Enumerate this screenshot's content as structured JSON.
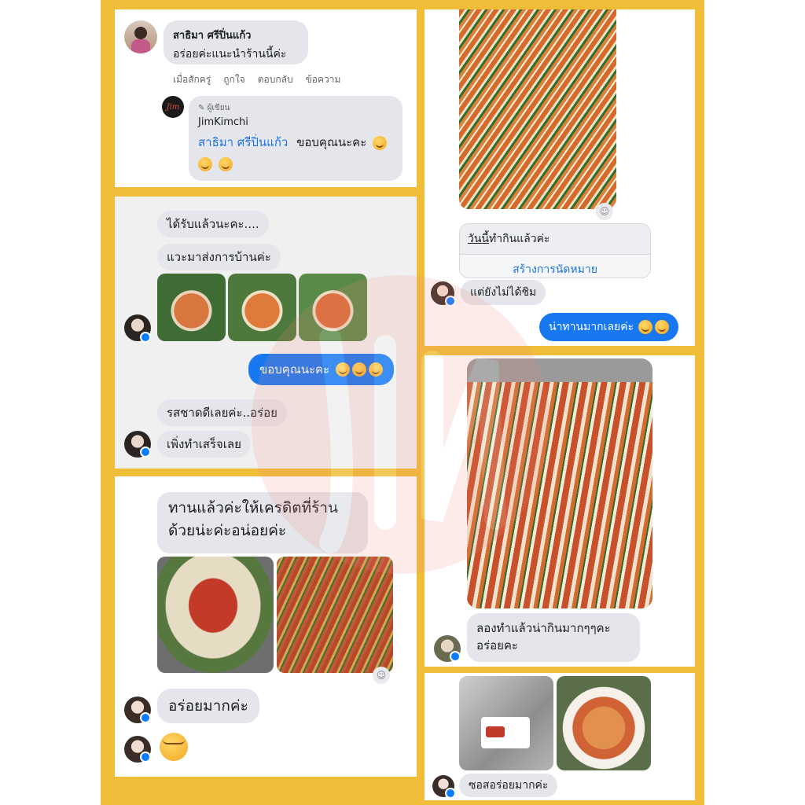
{
  "comment": {
    "author": "สาธิมา ศรีปิ่นแก้ว",
    "text": "อร่อยค่ะแนะนำร้านนี้ค่ะ",
    "time": "เมื่อสักครู่",
    "actions": [
      "ถูกใจ",
      "ตอบกลับ",
      "ข้อความ"
    ]
  },
  "reply": {
    "badge": "ผู้เขียน",
    "author": "JimKimchi",
    "mention": "สาธิมา ศรีปิ่นแก้ว",
    "text": "ขอบคุณนะคะ",
    "logo_text": "Jim"
  },
  "chat1": {
    "messages": [
      "ได้รับแล้วนะคะ....",
      "แวะมาส่งการบ้านค่ะ"
    ],
    "sent": "ขอบคุณนะคะ",
    "messages2": [
      "รสชาดดีเลยค่ะ..อร่อย",
      "เพิ่งทำเสร็จเลย"
    ]
  },
  "chat2": {
    "message": "ทานแล้วค่ะให้เครดิตที่ร้าน\nด้วยน่ะค่ะอน่อยค่ะ",
    "message2": "อร่อยมากค่ะ"
  },
  "chat3": {
    "card_title_underlined": "วันนี้",
    "card_title_rest": "ทำกินแล้วค่ะ",
    "card_button": "สร้างการนัดหมาย",
    "message": "แต่ยังไม่ได้ชิม",
    "sent": "น่าทานมากเลยค่ะ"
  },
  "chat4": {
    "message": "ลองทำแล้วน่ากินมากๆๆคะ\nอร่อยคะ"
  },
  "chat5": {
    "message": "ซอสอร่อยมากค่ะ"
  },
  "colors": {
    "frame": "#efbd38",
    "bubble": "#e4e6eb",
    "sent_bubble": "#1778f2",
    "link": "#1e74e6"
  }
}
